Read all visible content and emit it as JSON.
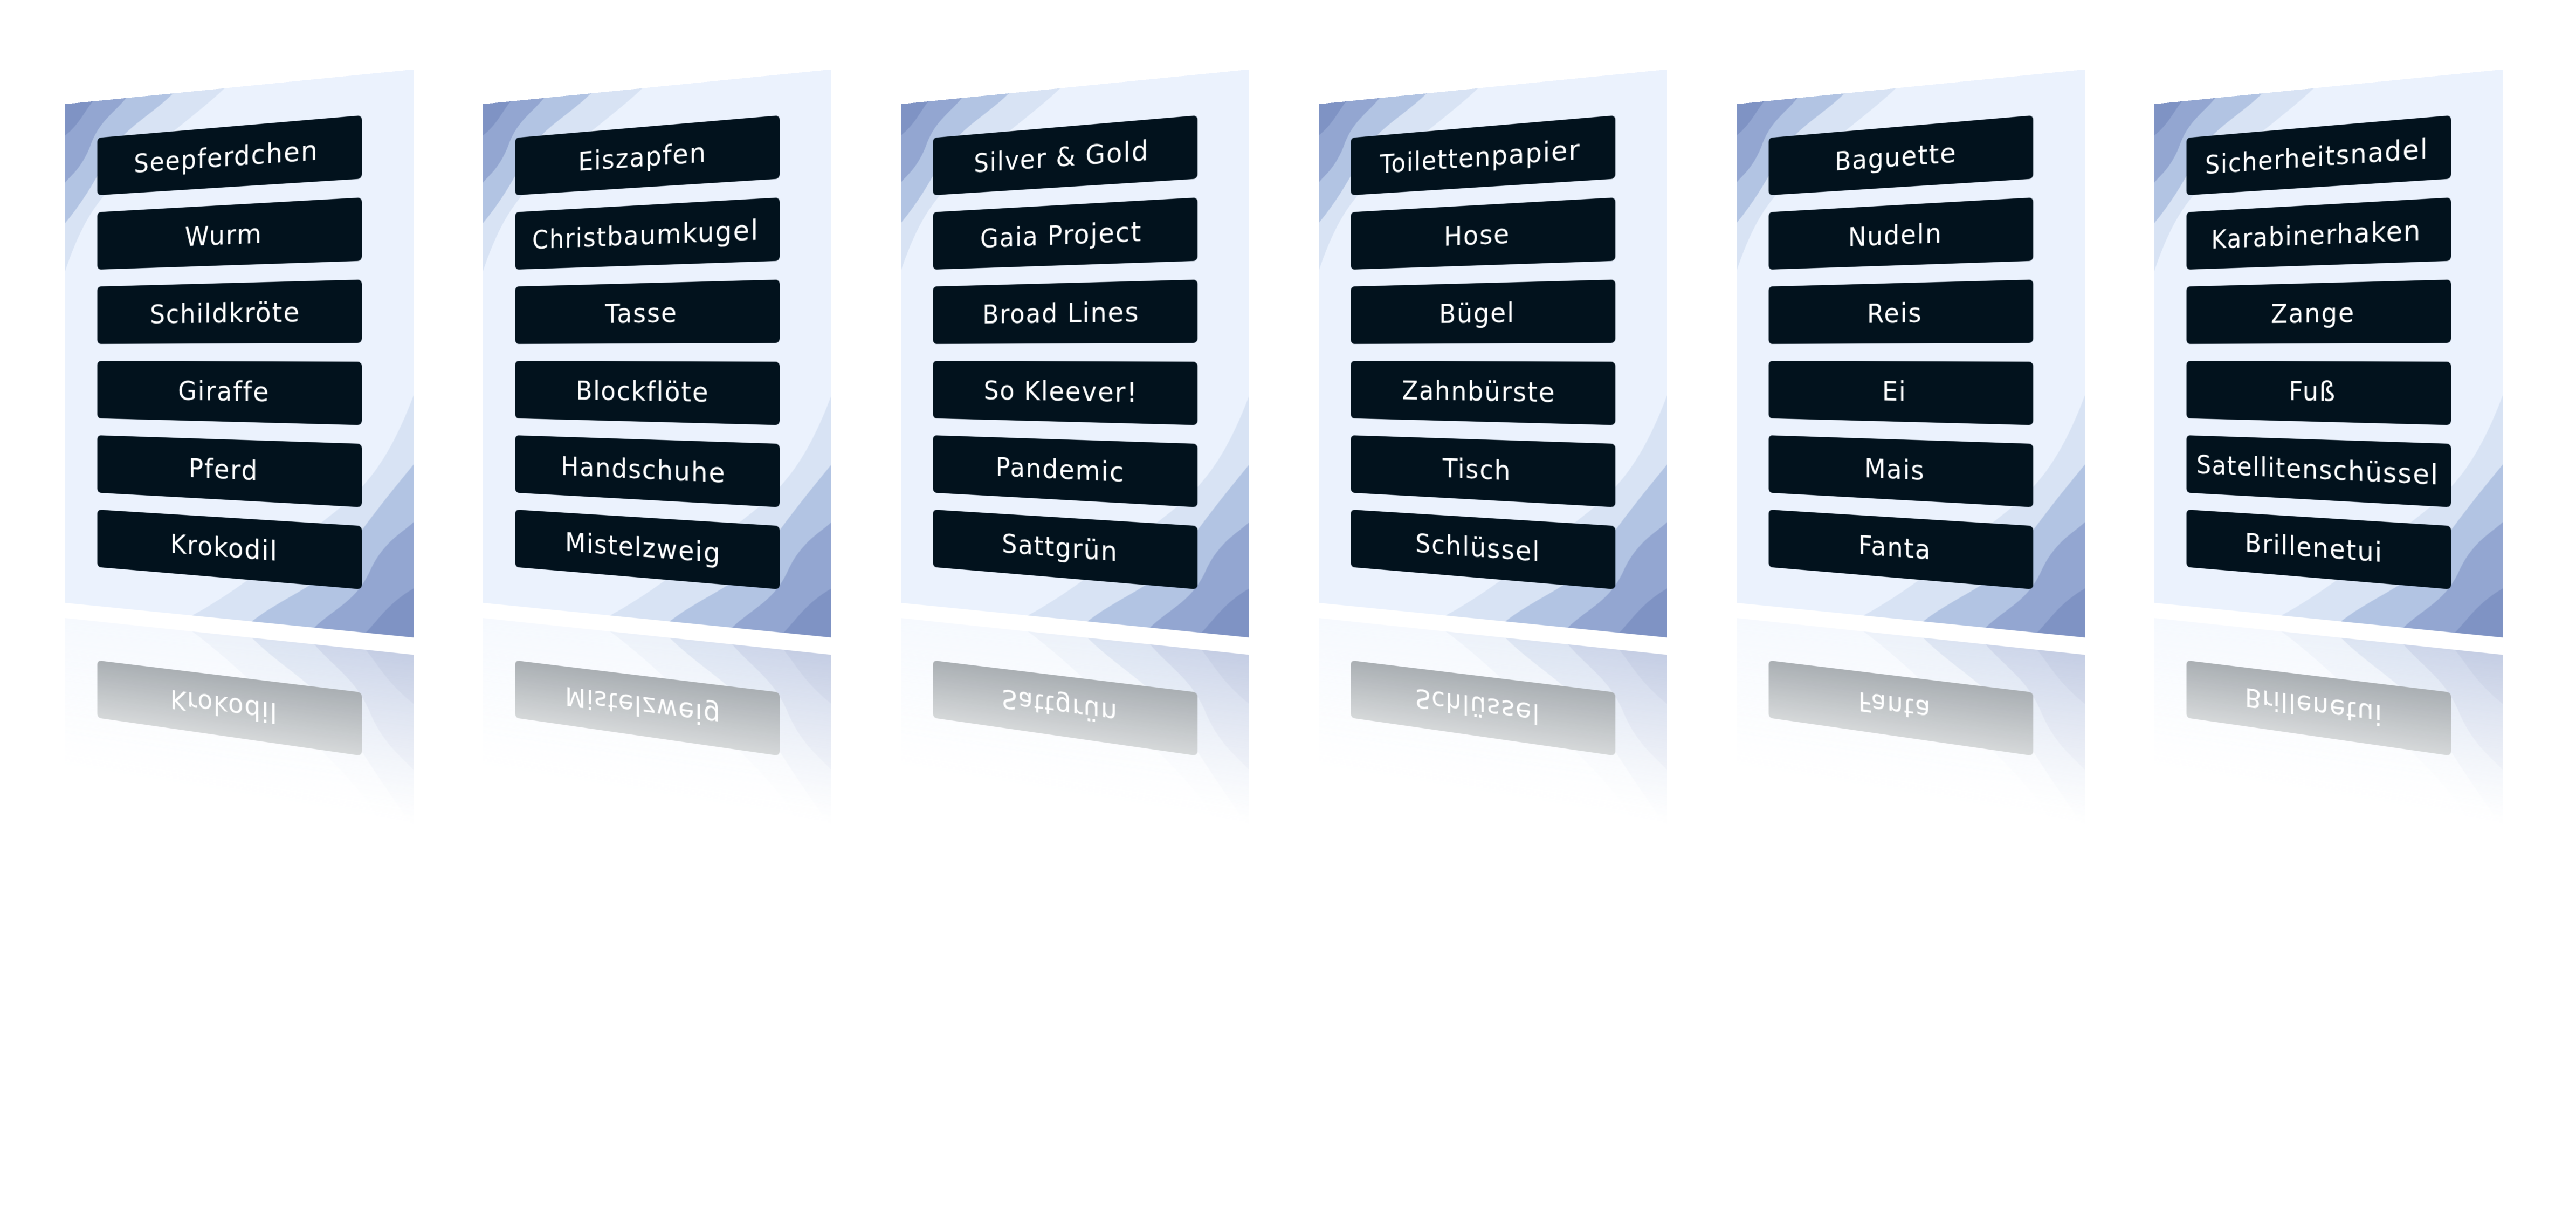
{
  "colors": {
    "card_background": "#ebf2fd",
    "label_background": "#02121d",
    "label_text": "#ffffff",
    "wave_colors": [
      "#d8e3f4",
      "#b2c4e3",
      "#93a6d1",
      "#7f93c4"
    ]
  },
  "cards": [
    {
      "labels": [
        "Seepferdchen",
        "Wurm",
        "Schildkröte",
        "Giraffe",
        "Pferd",
        "Krokodil"
      ]
    },
    {
      "labels": [
        "Eiszapfen",
        "Christbaumkugel",
        "Tasse",
        "Blockflöte",
        "Handschuhe",
        "Mistelzweig"
      ]
    },
    {
      "labels": [
        "Silver & Gold",
        "Gaia Project",
        "Broad Lines",
        "So Kleever!",
        "Pandemic",
        "Sattgrün"
      ]
    },
    {
      "labels": [
        "Toilettenpapier",
        "Hose",
        "Bügel",
        "Zahnbürste",
        "Tisch",
        "Schlüssel"
      ]
    },
    {
      "labels": [
        "Baguette",
        "Nudeln",
        "Reis",
        "Ei",
        "Mais",
        "Fanta"
      ]
    },
    {
      "labels": [
        "Sicherheitsnadel",
        "Karabinerhaken",
        "Zange",
        "Fuß",
        "Satellitenschüssel",
        "Brillenetui"
      ]
    }
  ]
}
